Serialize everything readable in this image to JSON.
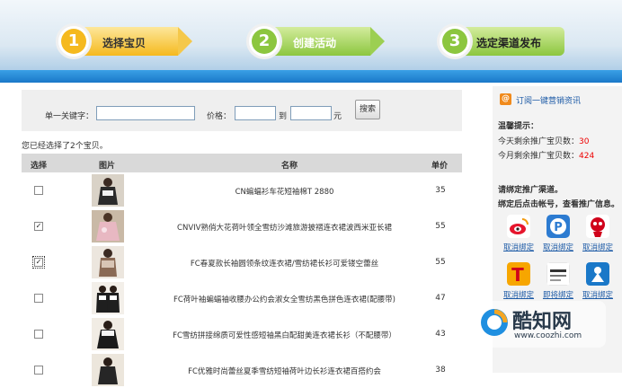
{
  "steps": [
    {
      "number": "1",
      "label": "选择宝贝"
    },
    {
      "number": "2",
      "label": "创建活动"
    },
    {
      "number": "3",
      "label": "选定渠道发布"
    }
  ],
  "search": {
    "keyword_label": "单一关键字：",
    "keyword_value": "",
    "price_label": "价格：",
    "price_min": "",
    "to_label": "到",
    "price_max": "",
    "currency": "元",
    "button_label": "搜索"
  },
  "selected_text": "您已经选择了2个宝贝。",
  "table": {
    "headers": {
      "select": "选择",
      "image": "图片",
      "name": "名称",
      "price": "单价"
    },
    "rows": [
      {
        "checked": false,
        "name": "CN蝙蝠衫车花短袖棉T 2880",
        "price": "35"
      },
      {
        "checked": true,
        "name": "CNVIV熟俏大花荷叶领全雪纺沙滩旅游披褶连衣裙波西米亚长裙",
        "price": "55"
      },
      {
        "checked": true,
        "name": "FC春夏款长袖圆领条纹连衣裙/雪纺裙长衫可爱镂空蕾丝",
        "price": "55"
      },
      {
        "checked": false,
        "name": "FC荷叶袖蝙蝠袖收腰办公约会淑女全雪纺黑色拼色连衣裙(配腰带)",
        "price": "47"
      },
      {
        "checked": false,
        "name": "FC雪纺拼接绵质可爱性感短袖黑白配甜美连衣裙长衫（不配腰带）",
        "price": "43"
      },
      {
        "checked": false,
        "name": "FC优雅时尚蕾丝夏季雪纺短袖荷叶边长衫连衣裙百搭约会",
        "price": "38"
      }
    ]
  },
  "sidebar": {
    "subscribe_icon": "@",
    "subscribe_link": "订阅一键营销资讯",
    "tips_title": "温馨提示：",
    "tip_day_label": "今天剩余推广宝贝数：",
    "tip_day_value": "30",
    "tip_month_label": "今月剩余推广宝贝数：",
    "tip_month_value": "424",
    "bind_line1": "请绑定推广渠道。",
    "bind_line2": "绑定后点击帐号，查看推广信息。",
    "channels": [
      {
        "icon": "weibo-icon",
        "label": "取消绑定"
      },
      {
        "icon": "p-icon",
        "label": "取消绑定"
      },
      {
        "icon": "red-mascot-icon",
        "label": "取消绑定"
      },
      {
        "icon": "t-icon",
        "label": "取消绑定"
      },
      {
        "icon": "tianya-icon",
        "label": "即将绑定"
      },
      {
        "icon": "person-icon",
        "label": "取消绑定"
      }
    ]
  },
  "watermark": {
    "brand": "酷知网",
    "url": "www.coozhi.com"
  },
  "colors": {
    "step1": "#f5b91e",
    "step2": "#8cc63f",
    "step3": "#8cc63f",
    "link": "#1c5aa6",
    "highlight": "#e00000",
    "banner_bar": "#1a78c8"
  }
}
